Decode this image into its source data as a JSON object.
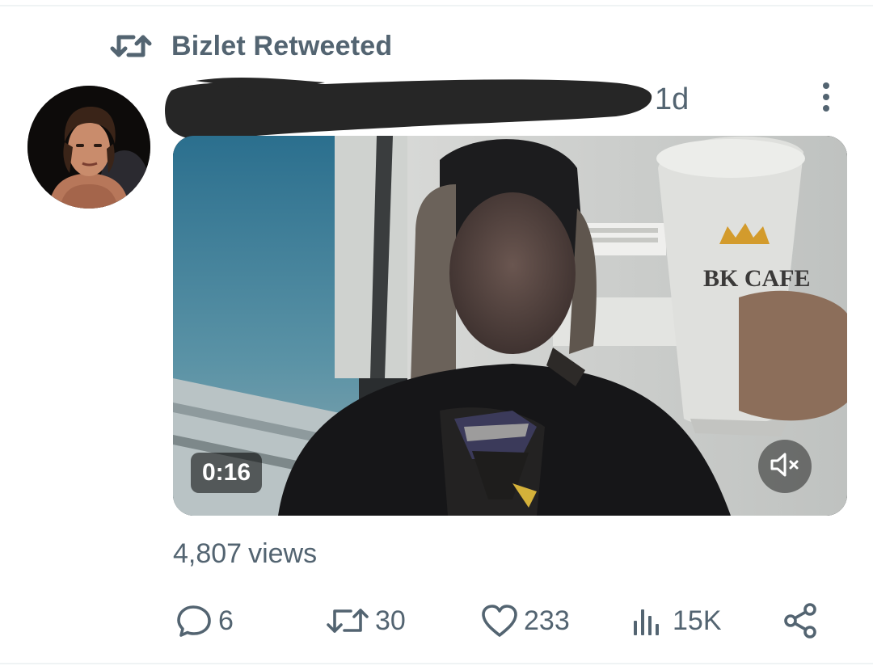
{
  "retweet_header": {
    "text": "Bizlet Retweeted",
    "icon": "retweet-icon"
  },
  "tweet": {
    "timestamp": "1d",
    "author_name_redacted": true,
    "media": {
      "type": "video",
      "duration": "0:16",
      "muted": true,
      "cup_text": "BK CAFE"
    },
    "views": {
      "count": "4,807",
      "label": "views"
    },
    "actions": {
      "reply": "6",
      "retweet": "30",
      "like": "233",
      "analytics": "15K"
    }
  },
  "colors": {
    "secondary_text": "#536471",
    "divider": "#eff3f4",
    "redaction": "#262626"
  },
  "icons": [
    "retweet-icon",
    "more-icon",
    "mute-icon",
    "reply-icon",
    "like-icon",
    "analytics-icon",
    "share-icon"
  ]
}
